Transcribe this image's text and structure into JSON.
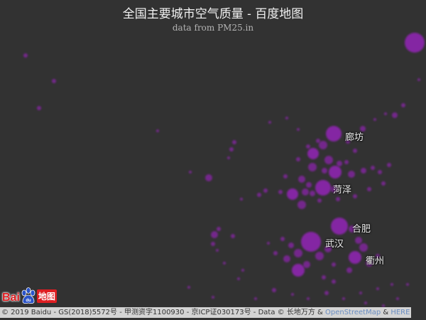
{
  "header": {
    "title": "全国主要城市空气质量 - 百度地图",
    "subtitle": "data from PM25.in"
  },
  "colors": {
    "background": "#323232",
    "marker": "#a020c8"
  },
  "labels": {
    "langfang": "廊坊",
    "heze": "菏泽",
    "hefei": "合肥",
    "wuhan": "武汉",
    "quzhou": "衢州"
  },
  "logo": {
    "bai": "Bai",
    "du": "du",
    "map": "地图",
    "icon": "paw-icon"
  },
  "footer": {
    "copyright": "© 2019 Baidu - GS(2018)5572号 - 甲测资字1100930 - 京ICP证030173号 - Data © 长地万方 & ",
    "osm_link": "OpenStreetMap",
    "amp": " & ",
    "here_link": "HERE"
  }
}
